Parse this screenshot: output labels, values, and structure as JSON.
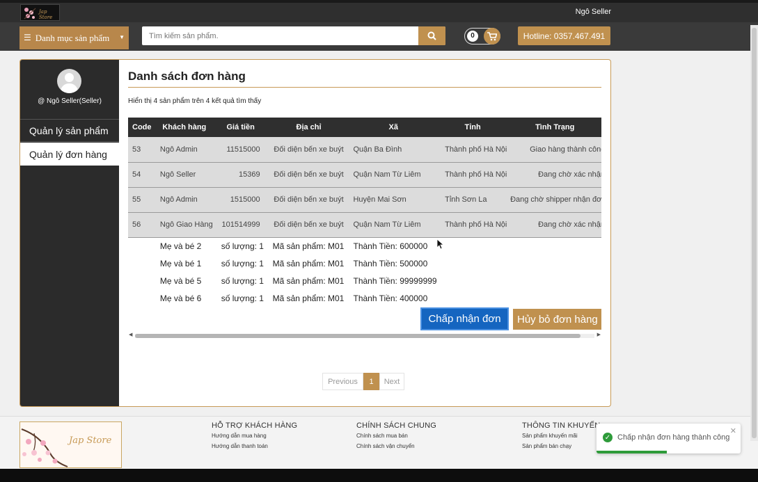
{
  "header": {
    "logo_text": "Jap Store",
    "user": "Ngô Seller",
    "category_button": "Danh mục sản phẩm",
    "search_placeholder": "Tìm kiếm sản phẩm.",
    "cart_count": "0",
    "hotline": "Hotline: 0357.467.491"
  },
  "sidebar": {
    "seller_label": "@ Ngô Seller(Seller)",
    "items": [
      {
        "label": "Quản lý sản phẩm",
        "active": false
      },
      {
        "label": "Quản lý đơn hàng",
        "active": true
      }
    ]
  },
  "main": {
    "title": "Danh sách đơn hàng",
    "results_text": "Hiển thị 4 sản phẩm trên 4 kết quả tìm thấy",
    "columns": [
      "Code",
      "Khách hàng",
      "Giá tiền",
      "Địa chỉ",
      "Xã",
      "Tỉnh",
      "Tình Trạng"
    ],
    "orders": [
      {
        "code": "53",
        "customer": "Ngô Admin",
        "price": "11515000",
        "address": "Đối diện bến xe buýt",
        "xa": "Quận Ba Đình",
        "tinh": "Thành phố Hà Nội",
        "status": "Giao hàng thành công"
      },
      {
        "code": "54",
        "customer": "Ngô Seller",
        "price": "15369",
        "address": "Đối diện bến xe buýt",
        "xa": "Quận Nam Từ Liêm",
        "tinh": "Thành phố Hà Nội",
        "status": "Đang chờ xác nhận"
      },
      {
        "code": "55",
        "customer": "Ngô Admin",
        "price": "1515000",
        "address": "Đối diện bến xe buýt",
        "xa": "Huyện Mai Sơn",
        "tinh": "Tỉnh Sơn La",
        "status": "Đang chờ shipper nhận đơn"
      },
      {
        "code": "56",
        "customer": "Ngô Giao Hàng",
        "price": "101514999",
        "address": "Đối diện bến xe buýt",
        "xa": "Quận Nam Từ Liêm",
        "tinh": "Thành phố Hà Nội",
        "status": "Đang chờ xác nhận"
      }
    ],
    "details": [
      {
        "product": "Mẹ và bé 2",
        "qty": "số lượng: 1",
        "sku": "Mã sản phẩm: M01",
        "total": "Thành Tiền: 600000"
      },
      {
        "product": "Mẹ và bé 1",
        "qty": "số lượng: 1",
        "sku": "Mã sản phẩm: M01",
        "total": "Thành Tiền: 500000"
      },
      {
        "product": "Mẹ và bé 5",
        "qty": "số lượng: 1",
        "sku": "Mã sản phẩm: M01",
        "total": "Thành Tiền: 99999999"
      },
      {
        "product": "Mẹ và bé 6",
        "qty": "số lượng: 1",
        "sku": "Mã sản phẩm: M01",
        "total": "Thành Tiền: 400000"
      }
    ],
    "accept_button": "Chấp nhận đơn",
    "cancel_button": "Hủy bỏ đơn hàng",
    "pagination": {
      "prev": "Previous",
      "current": "1",
      "next": "Next"
    }
  },
  "footer": {
    "logo_text": "Jap Store",
    "columns": [
      {
        "title": "HỖ TRỢ KHÁCH HÀNG",
        "links": [
          "Hướng dẫn mua hàng",
          "Hướng dẫn thanh toán"
        ]
      },
      {
        "title": "CHÍNH SÁCH CHUNG",
        "links": [
          "Chính sách mua bán",
          "Chính sách vận chuyển"
        ]
      },
      {
        "title": "THÔNG TIN KHUYẾN",
        "links": [
          "Sản phẩm khuyến mãi",
          "Sản phẩm bán chạy"
        ]
      }
    ]
  },
  "toast": {
    "message": "Chấp nhận đơn hàng thành công",
    "progress": 0.49
  },
  "colors": {
    "accent": "#c0914f",
    "dark": "#2f2f2f",
    "primary_button": "#1565c0",
    "success": "#2e9b3a"
  }
}
